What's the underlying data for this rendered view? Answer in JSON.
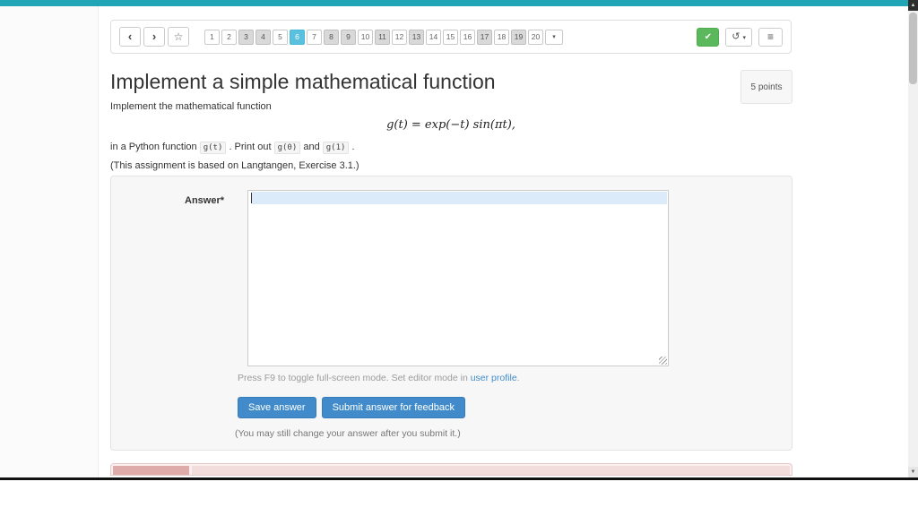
{
  "toolbar": {
    "prev": "‹",
    "next": "›",
    "star": "☆",
    "pages": [
      {
        "label": "1",
        "state": "default"
      },
      {
        "label": "2",
        "state": "default"
      },
      {
        "label": "3",
        "state": "muted"
      },
      {
        "label": "4",
        "state": "muted"
      },
      {
        "label": "5",
        "state": "default"
      },
      {
        "label": "6",
        "state": "active"
      },
      {
        "label": "7",
        "state": "default"
      },
      {
        "label": "8",
        "state": "muted"
      },
      {
        "label": "9",
        "state": "muted"
      },
      {
        "label": "10",
        "state": "default"
      },
      {
        "label": "11",
        "state": "muted"
      },
      {
        "label": "12",
        "state": "default"
      },
      {
        "label": "13",
        "state": "muted"
      },
      {
        "label": "14",
        "state": "default"
      },
      {
        "label": "15",
        "state": "default"
      },
      {
        "label": "16",
        "state": "default"
      },
      {
        "label": "17",
        "state": "muted"
      },
      {
        "label": "18",
        "state": "default"
      },
      {
        "label": "19",
        "state": "muted"
      },
      {
        "label": "20",
        "state": "default"
      }
    ],
    "page_dropdown_caret": "▾",
    "check": "✔",
    "undo": "↺",
    "undo_caret": "▾",
    "menu": "≡"
  },
  "assignment": {
    "title": "Implement a simple mathematical function",
    "points": "5 points",
    "intro": "Implement the mathematical function",
    "formula": "g(t) = exp(−t) sin(πt),",
    "line2": {
      "pre": "in a Python function",
      "code1": "g(t)",
      "mid1": ". Print out",
      "code2": "g(0)",
      "mid2": "and",
      "code3": "g(1)",
      "end": "."
    },
    "note": "(This assignment is based on Langtangen, Exercise 3.1.)"
  },
  "answer": {
    "label": "Answer*",
    "hint_pre": "Press F9 to toggle full-screen mode. Set editor mode in",
    "hint_link": "user profile",
    "hint_post": ".",
    "save": "Save answer",
    "submit": "Submit answer for feedback",
    "footnote": "(You may still change your answer after you submit it.)"
  },
  "scrollbar": {
    "up": "▲",
    "down": "▼"
  },
  "colors": {
    "accent_teal": "#21a6b8",
    "active_page_blue": "#5bc0de",
    "success_green": "#5cb85c",
    "primary_blue": "#428bca",
    "link_blue": "#428bca",
    "danger_pink": "#f2dcdc"
  }
}
